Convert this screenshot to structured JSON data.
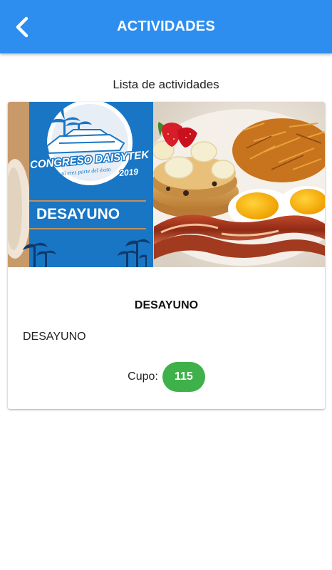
{
  "header": {
    "title": "ACTIVIDADES",
    "back_icon": "chevron-left-icon",
    "color": "#2d8ef0"
  },
  "section": {
    "title": "Lista de actividades"
  },
  "activity": {
    "image": {
      "banner_label": "DESAYUNO",
      "logo_title": "CONGRESO DAISYTEK",
      "logo_subtitle": "tú eres parte del éxito",
      "logo_year": "2019"
    },
    "title": "DESAYUNO",
    "description": "DESAYUNO",
    "cupo_label": "Cupo:",
    "cupo_value": "115",
    "badge_color": "#3fb14a"
  }
}
